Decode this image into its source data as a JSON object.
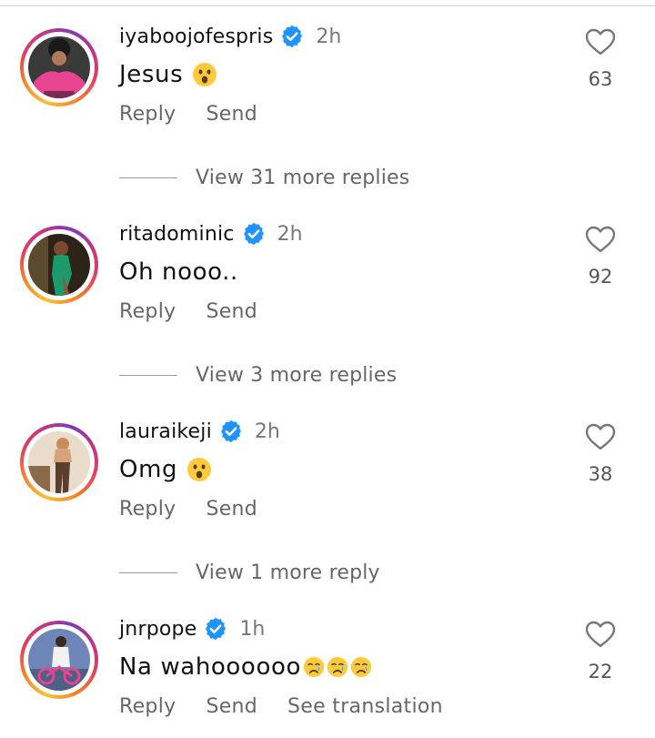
{
  "comments": [
    {
      "username": "iyaboojofespris",
      "time": "2h",
      "text": "Jesus",
      "emojis": [
        "astonished-face"
      ],
      "reply": "Reply",
      "send": "Send",
      "likes": "63",
      "view_replies": "View 31 more replies"
    },
    {
      "username": "ritadominic",
      "time": "2h",
      "text": "Oh nooo..",
      "emojis": [],
      "reply": "Reply",
      "send": "Send",
      "likes": "92",
      "view_replies": "View 3 more replies"
    },
    {
      "username": "lauraikeji",
      "time": "2h",
      "text": "Omg",
      "emojis": [
        "astonished-face"
      ],
      "reply": "Reply",
      "send": "Send",
      "likes": "38",
      "view_replies": "View 1 more reply"
    },
    {
      "username": "jnrpope",
      "time": "1h",
      "text": "Na wahoooooo",
      "emojis": [
        "crying-face",
        "crying-face",
        "crying-face"
      ],
      "reply": "Reply",
      "send": "Send",
      "see_translation": "See translation",
      "likes": "22"
    }
  ],
  "colors": {
    "verified_blue": "#1f93ff",
    "secondary_text": "#666666",
    "primary_text": "#111111"
  }
}
